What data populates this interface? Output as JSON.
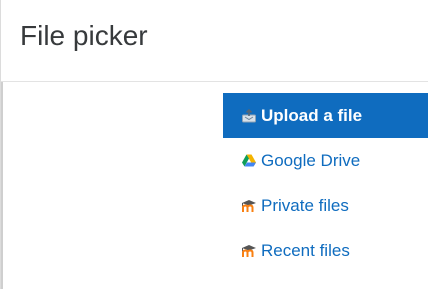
{
  "dialog": {
    "title": "File picker"
  },
  "repositories": {
    "items": [
      {
        "label": "Upload a file",
        "icon": "upload-icon",
        "active": true
      },
      {
        "label": "Google Drive",
        "icon": "google-drive-icon",
        "active": false
      },
      {
        "label": "Private files",
        "icon": "moodle-icon",
        "active": false
      },
      {
        "label": "Recent files",
        "icon": "moodle-icon",
        "active": false
      }
    ]
  },
  "colors": {
    "accent": "#0f6cbf",
    "title_text": "#373a3c",
    "active_text": "#ffffff"
  }
}
